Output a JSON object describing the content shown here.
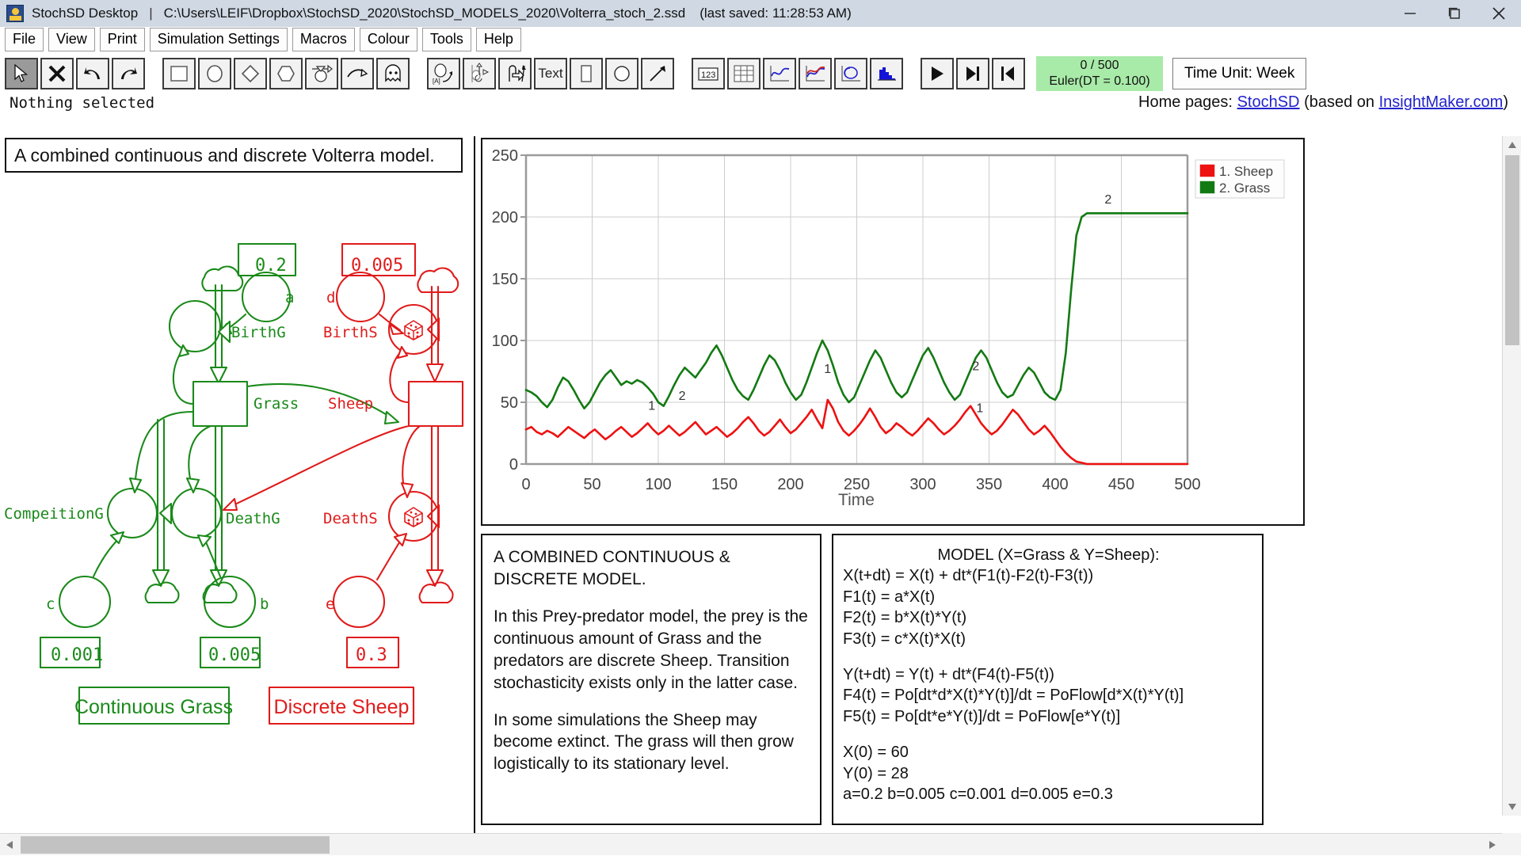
{
  "titlebar": {
    "app_name": "StochSD Desktop",
    "separator": "|",
    "file_path": "C:\\Users\\LEIF\\Dropbox\\StochSD_2020\\StochSD_MODELS_2020\\Volterra_stoch_2.ssd",
    "last_saved": "(last saved: 11:28:53 AM)",
    "minimize_label": "minimize-icon",
    "maximize_label": "maximize-icon",
    "close_label": "close-icon"
  },
  "menubar": {
    "items": [
      {
        "label": "File"
      },
      {
        "label": "View"
      },
      {
        "label": "Print"
      },
      {
        "label": "Simulation Settings"
      },
      {
        "label": "Macros"
      },
      {
        "label": "Colour"
      },
      {
        "label": "Tools"
      },
      {
        "label": "Help"
      }
    ]
  },
  "toolbar": {
    "tools": [
      {
        "name": "pointer-tool",
        "icon": "arrow-cursor-icon",
        "selected": true
      },
      {
        "name": "delete-tool",
        "icon": "x-delete-icon",
        "selected": false
      },
      {
        "name": "undo-tool",
        "icon": "undo-arrow-icon",
        "selected": false
      },
      {
        "name": "redo-tool",
        "icon": "redo-arrow-icon",
        "selected": false
      },
      {
        "name": "stock-tool",
        "icon": "rectangle-stock-icon",
        "selected": false
      },
      {
        "name": "auxiliary-tool",
        "icon": "ellipse-auxiliary-icon",
        "selected": false
      },
      {
        "name": "constant-tool",
        "icon": "diamond-constant-icon",
        "selected": false
      },
      {
        "name": "converter-tool",
        "icon": "hexagon-converter-icon",
        "selected": false
      },
      {
        "name": "flow-tool",
        "icon": "flow-valve-icon",
        "selected": false
      },
      {
        "name": "link-tool",
        "icon": "curved-link-icon",
        "selected": false
      },
      {
        "name": "ghost-tool",
        "icon": "ghost-icon",
        "selected": false
      },
      {
        "name": "named-value-tool",
        "icon": "ellipse-a-label-icon",
        "selected": false
      },
      {
        "name": "move-valve-tool",
        "icon": "move-valve-icon",
        "selected": false
      },
      {
        "name": "flow-arrow-tool",
        "icon": "flow-arrow-icon",
        "selected": false
      },
      {
        "name": "text-tool",
        "icon": "text-icon",
        "label": "Text",
        "selected": false
      },
      {
        "name": "rectangle-tool",
        "icon": "rectangle-shape-icon",
        "selected": false
      },
      {
        "name": "circle-tool",
        "icon": "circle-shape-icon",
        "selected": false
      },
      {
        "name": "line-tool",
        "icon": "diagonal-line-icon",
        "selected": false
      },
      {
        "name": "numberbox-tool",
        "icon": "numberbox-123-icon",
        "label": "123",
        "selected": false
      },
      {
        "name": "table-tool",
        "icon": "table-grid-icon",
        "selected": false
      },
      {
        "name": "timeplot-tool",
        "icon": "timeplot-blue-curve-icon",
        "selected": false
      },
      {
        "name": "comparison-plot-tool",
        "icon": "compare-plot-icon",
        "selected": false
      },
      {
        "name": "xy-plot-tool",
        "icon": "xy-loop-plot-icon",
        "selected": false
      },
      {
        "name": "histogram-tool",
        "icon": "histogram-icon",
        "selected": false
      },
      {
        "name": "run-button",
        "icon": "play-icon",
        "selected": false
      },
      {
        "name": "step-button",
        "icon": "step-forward-icon",
        "selected": false
      },
      {
        "name": "reset-button",
        "icon": "rewind-icon",
        "selected": false
      }
    ],
    "sim_status_progress": "0 / 500",
    "sim_status_method": "Euler(DT = 0.100)",
    "sim_status_bg": "#a8eaa8",
    "time_unit_label": "Time Unit: Week"
  },
  "statusbar": {
    "selection_text": "Nothing selected",
    "homepages_prefix": "Home pages:",
    "homepage_link_1": "StochSD",
    "homepages_middle": "(based on",
    "homepage_link_2": "InsightMaker.com",
    "homepages_suffix": ")",
    "link_color": "#2222cc"
  },
  "diagram": {
    "title": "A combined continuous and discrete Volterra model.",
    "green": "#1a8a1a",
    "red": "#e01b1b",
    "constants": [
      {
        "name": "a-value",
        "value": "0.2",
        "color": "green"
      },
      {
        "name": "d-value",
        "value": "0.005",
        "color": "red"
      },
      {
        "name": "c-value",
        "value": "0.001",
        "color": "green"
      },
      {
        "name": "b-value",
        "value": "0.005",
        "color": "green"
      },
      {
        "name": "e-value",
        "value": "0.3",
        "color": "red"
      }
    ],
    "labels": {
      "a": "a",
      "b": "b",
      "c": "c",
      "d": "d",
      "e": "e",
      "birth_g": "BirthG",
      "birth_s": "BirthS",
      "death_g": "DeathG",
      "death_s": "DeathS",
      "grass": "Grass",
      "sheep": "Sheep",
      "competition_g": "CompeitionG"
    },
    "tag_continuous": "Continuous Grass",
    "tag_discrete": "Discrete Sheep"
  },
  "chart_data": {
    "type": "line",
    "title": "",
    "xlabel": "Time",
    "ylabel": "",
    "xlim": [
      0,
      500
    ],
    "ylim": [
      0,
      250
    ],
    "xticks": [
      0,
      50,
      100,
      150,
      200,
      250,
      300,
      350,
      400,
      450,
      500
    ],
    "yticks": [
      0,
      50,
      100,
      150,
      200,
      250
    ],
    "grid": true,
    "legend_position": "top-right",
    "legend": [
      {
        "key": "1",
        "name": "1. Sheep",
        "color": "#ee1111"
      },
      {
        "key": "2",
        "name": "2. Grass",
        "color": "#137a13"
      }
    ],
    "inline_labels": [
      {
        "text": "1",
        "x": 95,
        "y": 40
      },
      {
        "text": "2",
        "x": 118,
        "y": 48
      },
      {
        "text": "1",
        "x": 228,
        "y": 70
      },
      {
        "text": "2",
        "x": 340,
        "y": 72
      },
      {
        "text": "1",
        "x": 343,
        "y": 38
      },
      {
        "text": "2",
        "x": 440,
        "y": 207
      }
    ],
    "series": [
      {
        "name": "1. Sheep",
        "color": "#ee1111",
        "x": [
          0,
          4,
          8,
          12,
          16,
          20,
          24,
          28,
          32,
          36,
          40,
          44,
          48,
          52,
          56,
          60,
          64,
          68,
          72,
          76,
          80,
          84,
          88,
          92,
          96,
          100,
          104,
          108,
          112,
          116,
          120,
          124,
          128,
          132,
          136,
          140,
          144,
          148,
          152,
          156,
          160,
          164,
          168,
          172,
          176,
          180,
          184,
          188,
          192,
          196,
          200,
          204,
          208,
          212,
          216,
          220,
          224,
          228,
          232,
          236,
          240,
          244,
          248,
          252,
          256,
          260,
          264,
          268,
          272,
          276,
          280,
          284,
          288,
          292,
          296,
          300,
          304,
          308,
          312,
          316,
          320,
          324,
          328,
          332,
          336,
          340,
          344,
          348,
          352,
          356,
          360,
          364,
          368,
          372,
          376,
          380,
          384,
          388,
          392,
          396,
          400,
          404,
          408,
          412,
          416,
          420,
          424,
          428,
          432,
          436,
          440,
          450,
          460,
          470,
          480,
          490,
          500
        ],
        "values": [
          28,
          30,
          26,
          24,
          27,
          25,
          22,
          26,
          30,
          27,
          24,
          21,
          25,
          28,
          24,
          20,
          23,
          27,
          30,
          26,
          22,
          25,
          29,
          33,
          28,
          24,
          27,
          31,
          27,
          23,
          26,
          30,
          34,
          29,
          24,
          27,
          30,
          26,
          22,
          25,
          29,
          34,
          38,
          33,
          27,
          23,
          26,
          31,
          36,
          30,
          25,
          28,
          33,
          38,
          44,
          36,
          29,
          52,
          45,
          34,
          27,
          23,
          27,
          32,
          38,
          45,
          38,
          30,
          25,
          28,
          33,
          30,
          26,
          23,
          27,
          32,
          37,
          33,
          28,
          24,
          27,
          31,
          36,
          42,
          47,
          40,
          33,
          28,
          24,
          27,
          32,
          38,
          44,
          40,
          34,
          28,
          24,
          27,
          31,
          26,
          20,
          14,
          9,
          5,
          2,
          1,
          0,
          0,
          0,
          0,
          0,
          0,
          0,
          0,
          0,
          0,
          0
        ]
      },
      {
        "name": "2. Grass",
        "color": "#137a13",
        "x": [
          0,
          4,
          8,
          12,
          16,
          20,
          24,
          28,
          32,
          36,
          40,
          44,
          48,
          52,
          56,
          60,
          64,
          68,
          72,
          76,
          80,
          84,
          88,
          92,
          96,
          100,
          104,
          108,
          112,
          116,
          120,
          124,
          128,
          132,
          136,
          140,
          144,
          148,
          152,
          156,
          160,
          164,
          168,
          172,
          176,
          180,
          184,
          188,
          192,
          196,
          200,
          204,
          208,
          212,
          216,
          220,
          224,
          228,
          232,
          236,
          240,
          244,
          248,
          252,
          256,
          260,
          264,
          268,
          272,
          276,
          280,
          284,
          288,
          292,
          296,
          300,
          304,
          308,
          312,
          316,
          320,
          324,
          328,
          332,
          336,
          340,
          344,
          348,
          352,
          356,
          360,
          364,
          368,
          372,
          376,
          380,
          384,
          388,
          392,
          396,
          400,
          404,
          408,
          412,
          416,
          420,
          424,
          428,
          432,
          436,
          440,
          450,
          460,
          470,
          480,
          490,
          500
        ],
        "values": [
          60,
          58,
          55,
          50,
          46,
          52,
          62,
          70,
          67,
          60,
          52,
          45,
          50,
          58,
          66,
          72,
          76,
          70,
          64,
          67,
          65,
          68,
          66,
          62,
          57,
          50,
          47,
          55,
          64,
          72,
          78,
          74,
          70,
          76,
          82,
          90,
          96,
          88,
          78,
          68,
          60,
          55,
          52,
          60,
          70,
          80,
          88,
          84,
          76,
          66,
          58,
          52,
          56,
          66,
          78,
          90,
          100,
          92,
          80,
          66,
          56,
          50,
          54,
          64,
          74,
          84,
          92,
          86,
          76,
          66,
          58,
          54,
          58,
          68,
          78,
          88,
          94,
          86,
          76,
          66,
          58,
          52,
          56,
          66,
          76,
          86,
          92,
          86,
          76,
          66,
          58,
          54,
          56,
          64,
          72,
          78,
          74,
          66,
          58,
          54,
          52,
          60,
          90,
          140,
          185,
          200,
          203,
          203,
          203,
          203,
          203,
          203,
          203,
          203,
          203,
          203,
          203
        ]
      }
    ]
  },
  "description_box": {
    "heading_line_1": "A COMBINED CONTINUOUS &",
    "heading_line_2": "DISCRETE MODEL.",
    "paragraph_1": "In this Prey-predator model, the prey is the continuous amount of Grass and the predators are discrete Sheep. Transition stochasticity exists only in the latter case.",
    "paragraph_2": "In some simulations the Sheep may become extinct. The grass will then grow logistically to its stationary level."
  },
  "model_box": {
    "title": "MODEL (X=Grass & Y=Sheep):",
    "lines_group_1": [
      "X(t+dt) = X(t) + dt*(F1(t)-F2(t)-F3(t))",
      "F1(t) = a*X(t)",
      "F2(t) = b*X(t)*Y(t)",
      "F3(t) = c*X(t)*X(t)"
    ],
    "lines_group_2": [
      "Y(t+dt) = Y(t) + dt*(F4(t)-F5(t))",
      "F4(t) = Po[dt*d*X(t)*Y(t)]/dt = PoFlow[d*X(t)*Y(t)]",
      "F5(t) = Po[dt*e*Y(t)]/dt = PoFlow[e*Y(t)]"
    ],
    "lines_group_3": [
      "X(0) = 60",
      "Y(0) = 28",
      "a=0.2  b=0.005  c=0.001  d=0.005  e=0.3"
    ]
  },
  "scrollbars": {
    "vertical_name": "vertical-scrollbar",
    "horizontal_name": "horizontal-scrollbar"
  }
}
